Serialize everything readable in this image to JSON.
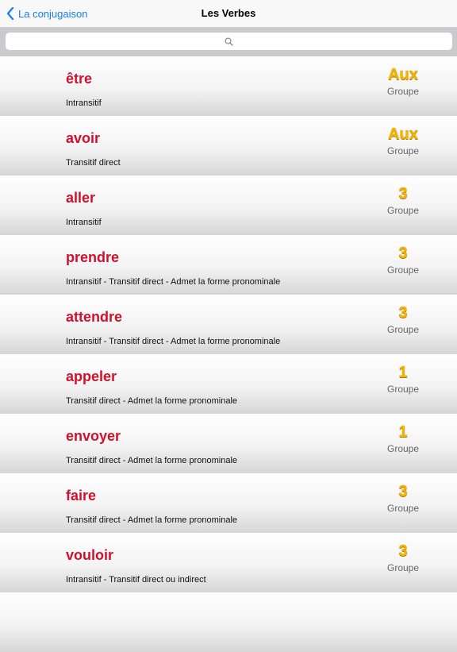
{
  "navbar": {
    "back_label": "La conjugaison",
    "title": "Les Verbes"
  },
  "search": {
    "value": "",
    "placeholder": ""
  },
  "colors": {
    "accent": "#147efb",
    "verb": "#d0102d",
    "group": "#f4b400"
  },
  "verbs": [
    {
      "name": "être",
      "description": "Intransitif",
      "group": "Aux",
      "group_label": "Groupe"
    },
    {
      "name": "avoir",
      "description": "Transitif direct",
      "group": "Aux",
      "group_label": "Groupe"
    },
    {
      "name": "aller",
      "description": "Intransitif",
      "group": "3",
      "group_label": "Groupe"
    },
    {
      "name": "prendre",
      "description": "Intransitif - Transitif direct - Admet la forme pronominale",
      "group": "3",
      "group_label": "Groupe"
    },
    {
      "name": "attendre",
      "description": "Intransitif - Transitif direct - Admet la forme pronominale",
      "group": "3",
      "group_label": "Groupe"
    },
    {
      "name": "appeler",
      "description": "Transitif direct - Admet la forme pronominale",
      "group": "1",
      "group_label": "Groupe"
    },
    {
      "name": "envoyer",
      "description": "Transitif direct - Admet la forme pronominale",
      "group": "1",
      "group_label": "Groupe"
    },
    {
      "name": "faire",
      "description": "Transitif direct - Admet la forme pronominale",
      "group": "3",
      "group_label": "Groupe"
    },
    {
      "name": "vouloir",
      "description": "Intransitif - Transitif direct ou indirect",
      "group": "3",
      "group_label": "Groupe"
    },
    {
      "name": "",
      "description": "",
      "group": "",
      "group_label": ""
    }
  ]
}
